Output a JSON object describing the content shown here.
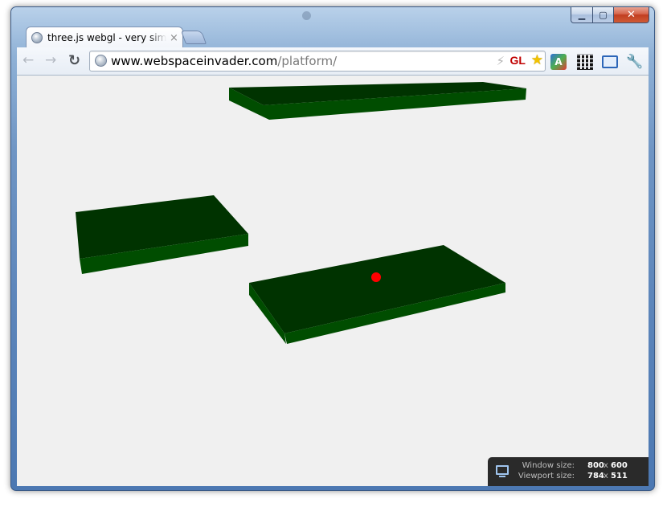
{
  "window": {
    "caption": {
      "minimize_glyph": "▁",
      "maximize_glyph": "▢",
      "close_glyph": "✕"
    }
  },
  "tab": {
    "title": "three.js webgl - very simple",
    "close_glyph": "×"
  },
  "toolbar": {
    "back_glyph": "←",
    "forward_glyph": "→",
    "reload_glyph": "↻",
    "address_host": "www.webspaceinvader.com",
    "address_path": "/platform/",
    "bolt_glyph": "⚡",
    "gl_badge": "GL",
    "star_glyph": "★",
    "translate_glyph": "A",
    "wrench_glyph": "🔧"
  },
  "scene": {
    "platform_color_top": "#003300",
    "platform_color_side": "#004d00",
    "background": "#f0f0f0",
    "marker_color": "#ff0000"
  },
  "size_overlay": {
    "window_label": "Window size:",
    "window_w": "800",
    "window_x": "x",
    "window_h": "600",
    "viewport_label": "Viewport size:",
    "viewport_w": "784",
    "viewport_x": "x",
    "viewport_h": "511"
  }
}
